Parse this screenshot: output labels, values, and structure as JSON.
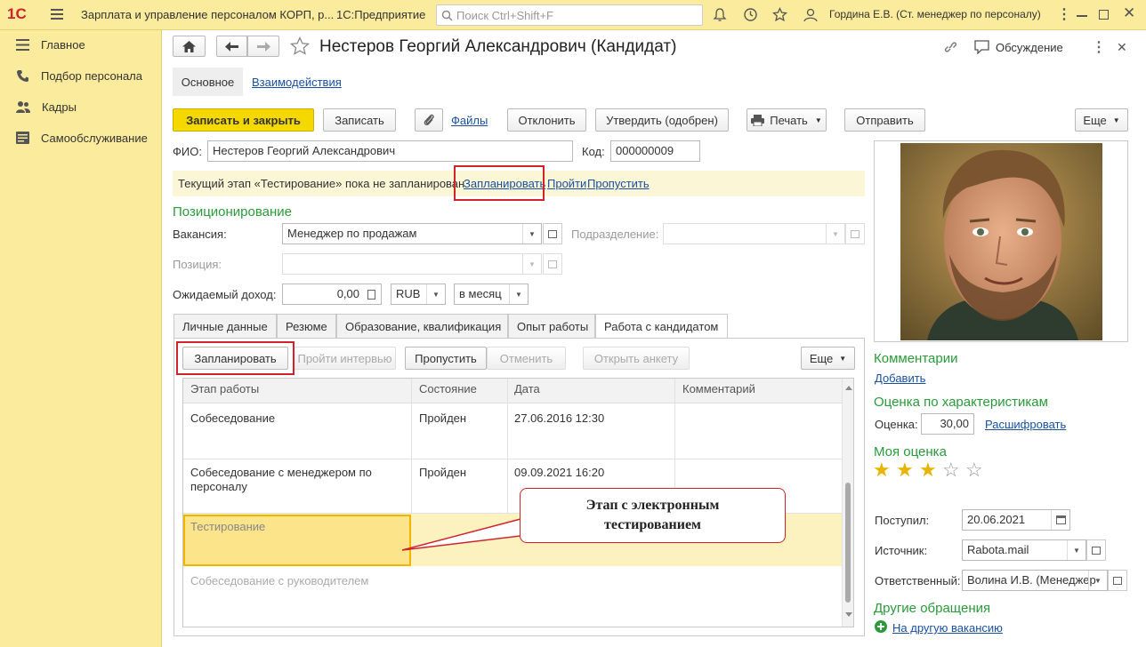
{
  "app": {
    "logo": "1С",
    "title": "Зарплата и управление персоналом КОРП, р...",
    "platform": "1С:Предприятие",
    "search_placeholder": "Поиск Ctrl+Shift+F",
    "user": "Гордина Е.В. (Ст. менеджер по персоналу)"
  },
  "sidebar": {
    "items": [
      {
        "label": "Главное",
        "icon": "menu-lines-icon"
      },
      {
        "label": "Подбор персонала",
        "icon": "phone-icon"
      },
      {
        "label": "Кадры",
        "icon": "people-icon"
      },
      {
        "label": "Самообслуживание",
        "icon": "self-service-icon"
      }
    ]
  },
  "form": {
    "title": "Нестеров Георгий Александрович (Кандидат)",
    "discussion": "Обсуждение",
    "tabs_top": [
      "Основное",
      "Взаимодействия"
    ],
    "toolbar": {
      "save_close": "Записать и закрыть",
      "save": "Записать",
      "files": "Файлы",
      "reject": "Отклонить",
      "approve": "Утвердить (одобрен)",
      "print": "Печать",
      "send": "Отправить",
      "more": "Еще"
    },
    "fio_label": "ФИО:",
    "fio_value": "Нестеров Георгий Александрович",
    "code_label": "Код:",
    "code_value": "000000009",
    "notice": {
      "text": "Текущий этап «Тестирование» пока не запланирован",
      "plan": "Запланировать",
      "pass": "Пройти",
      "skip": "Пропустить"
    },
    "positioning": {
      "header": "Позиционирование",
      "vacancy_label": "Вакансия:",
      "vacancy_value": "Менеджер по продажам",
      "department_label": "Подразделение:",
      "position_label": "Позиция:",
      "income_label": "Ожидаемый доход:",
      "income_value": "0,00",
      "currency": "RUB",
      "period": "в месяц"
    },
    "tabs": [
      "Личные данные",
      "Резюме",
      "Образование, квалификация",
      "Опыт работы",
      "Работа с кандидатом"
    ],
    "work": {
      "plan_btn": "Запланировать",
      "interview_btn": "Пройти интервью",
      "skip_btn": "Пропустить",
      "cancel_btn": "Отменить",
      "open_form_btn": "Открыть анкету",
      "more": "Еще",
      "columns": [
        "Этап работы",
        "Состояние",
        "Дата",
        "Комментарий"
      ],
      "rows": [
        {
          "stage": "Собеседование",
          "state": "Пройден",
          "date": "27.06.2016 12:30"
        },
        {
          "stage": "Собеседование с менеджером по персоналу",
          "state": "Пройден",
          "date": "09.09.2021 16:20"
        },
        {
          "stage": "Тестирование",
          "state": "",
          "date": ""
        },
        {
          "stage": "Собеседование с руководителем",
          "state": "",
          "date": ""
        }
      ]
    },
    "callout": "Этап с электронным тестированием",
    "right": {
      "comments_header": "Комментарии",
      "add": "Добавить",
      "rating_header": "Оценка по характеристикам",
      "rating_label": "Оценка:",
      "rating_value": "30,00",
      "decode": "Расшифровать",
      "my_rating_header": "Моя оценка",
      "my_rating": 3,
      "my_rating_max": 5,
      "received_label": "Поступил:",
      "received_value": "20.06.2021",
      "source_label": "Источник:",
      "source_value": "Rabota.mail",
      "responsible_label": "Ответственный:",
      "responsible_value": "Волина И.В. (Менеджер",
      "other_header": "Другие обращения",
      "other_link": "На другую вакансию"
    }
  },
  "colors": {
    "accent_yellow": "#fbeb9c",
    "green_header": "#2a9a3a",
    "link_blue": "#1a4fa0",
    "highlight_red": "#d0232a"
  }
}
